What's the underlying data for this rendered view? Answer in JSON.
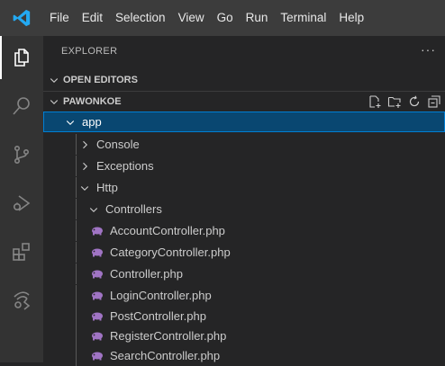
{
  "menu": [
    "File",
    "Edit",
    "Selection",
    "View",
    "Go",
    "Run",
    "Terminal",
    "Help"
  ],
  "activity_icons": [
    "explorer-icon",
    "search-icon",
    "source-control-icon",
    "run-debug-icon",
    "extensions-icon",
    "remote-explorer-icon"
  ],
  "explorer": {
    "title": "EXPLORER",
    "more": "···",
    "open_editors": "OPEN EDITORS",
    "workspace": "PAWONKOE",
    "workspace_actions": [
      "new-file-icon",
      "new-folder-icon",
      "refresh-icon",
      "collapse-all-icon"
    ]
  },
  "tree": {
    "app": "app",
    "console": "Console",
    "exceptions": "Exceptions",
    "http": "Http",
    "controllers": "Controllers",
    "files": [
      "AccountController.php",
      "CategoryController.php",
      "Controller.php",
      "LoginController.php",
      "PostController.php",
      "RegisterController.php",
      "SearchController.php"
    ]
  },
  "colors": {
    "accent": "#007acc",
    "selection": "#094771",
    "php_icon": "#a074c4",
    "vscode_blue": "#23a9f2"
  }
}
